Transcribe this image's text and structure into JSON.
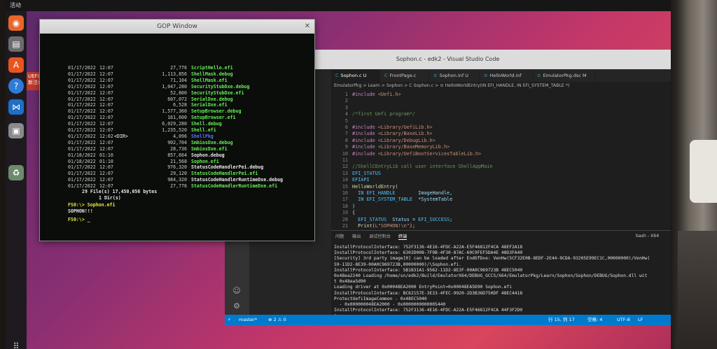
{
  "topbar": {
    "activities": "活动"
  },
  "dock": {
    "items": [
      {
        "name": "firefox-icon",
        "color": "#e8662a",
        "glyph": "◉"
      },
      {
        "name": "files-icon",
        "color": "#6c6c6c",
        "glyph": "▤"
      },
      {
        "name": "software-icon",
        "color": "#e95420",
        "glyph": "A"
      },
      {
        "name": "help-icon",
        "color": "#2f7bd8",
        "glyph": "?"
      },
      {
        "name": "vscode-icon",
        "color": "#1e6fc6",
        "glyph": "⋈"
      },
      {
        "name": "app-icon-1",
        "color": "#8a8a8a",
        "glyph": "▣"
      },
      {
        "name": "trash-icon",
        "color": "#6d8a6d",
        "glyph": "♻"
      }
    ],
    "uefi_label": "UEFI读\n新注卓"
  },
  "gop": {
    "title": "GOP Window",
    "rows": [
      {
        "date": "01/17/2022",
        "time": "12:07",
        "kind": "",
        "size": "27,776",
        "name": "ScriptHello.efi",
        "type": "file"
      },
      {
        "date": "01/17/2022",
        "time": "12:07",
        "kind": "",
        "size": "1,113,856",
        "name": "ShellMask.debug",
        "type": "file"
      },
      {
        "date": "01/17/2022",
        "time": "12:07",
        "kind": "",
        "size": "71,104",
        "name": "ShellMask.efi",
        "type": "file"
      },
      {
        "date": "01/17/2022",
        "time": "12:07",
        "kind": "",
        "size": "1,047,280",
        "name": "SecurityStubDxe.debug",
        "type": "file"
      },
      {
        "date": "01/17/2022",
        "time": "12:07",
        "kind": "",
        "size": "52,800",
        "name": "SecurityStubDxe.efi",
        "type": "file"
      },
      {
        "date": "01/17/2022",
        "time": "12:07",
        "kind": "",
        "size": "607,072",
        "name": "SerialDxe.debug",
        "type": "file"
      },
      {
        "date": "01/17/2022",
        "time": "12:07",
        "kind": "",
        "size": "6,528",
        "name": "SerialDxe.efi",
        "type": "file"
      },
      {
        "date": "01/17/2022",
        "time": "12:07",
        "kind": "",
        "size": "1,577,360",
        "name": "SetupBrowser.debug",
        "type": "file"
      },
      {
        "date": "01/17/2022",
        "time": "12:07",
        "kind": "",
        "size": "161,600",
        "name": "SetupBrowser.efi",
        "type": "file"
      },
      {
        "date": "01/17/2022",
        "time": "12:07",
        "kind": "",
        "size": "6,029,280",
        "name": "Shell.debug",
        "type": "file"
      },
      {
        "date": "01/17/2022",
        "time": "12:07",
        "kind": "",
        "size": "1,235,520",
        "name": "Shell.efi",
        "type": "file"
      },
      {
        "date": "01/17/2022",
        "time": "12:02",
        "kind": "<DIR>",
        "size": "4,096",
        "name": "ShellPkg",
        "type": "dir"
      },
      {
        "date": "01/17/2022",
        "time": "12:07",
        "kind": "",
        "size": "902,704",
        "name": "SmbiosDxe.debug",
        "type": "file"
      },
      {
        "date": "01/17/2022",
        "time": "12:07",
        "kind": "",
        "size": "28,736",
        "name": "SmbiosDxe.efi",
        "type": "file"
      },
      {
        "date": "01/18/2022",
        "time": "01:10",
        "kind": "",
        "size": "857,664",
        "name": "Sophon.debug",
        "type": "plain"
      },
      {
        "date": "01/18/2022",
        "time": "01:10",
        "kind": "",
        "size": "21,568",
        "name": "Sophon.efi",
        "type": "file"
      },
      {
        "date": "01/17/2022",
        "time": "12:07",
        "kind": "",
        "size": "976,320",
        "name": "StatusCodeHandlerPei.debug",
        "type": "plain"
      },
      {
        "date": "01/17/2022",
        "time": "12:07",
        "kind": "",
        "size": "29,120",
        "name": "StatusCodeHandlerPei.efi",
        "type": "file"
      },
      {
        "date": "01/17/2022",
        "time": "12:07",
        "kind": "",
        "size": "984,320",
        "name": "StatusCodeHandlerRuntimeDxe.debug",
        "type": "plain"
      },
      {
        "date": "01/17/2022",
        "time": "12:07",
        "kind": "",
        "size": "27,776",
        "name": "StatusCodeHandlerRuntimeDxe.efi",
        "type": "file"
      }
    ],
    "summary_files": "29 File(s)   17,450,056 bytes",
    "summary_dirs": "1 Dir(s)",
    "cmd": "FS0:\\> Sophon.efi",
    "output": "SOPHON!!!",
    "prompt": "FS0:\\> _"
  },
  "vscode": {
    "title": "Sophon.c - edk2 - Visual Studio Code",
    "tabs": [
      {
        "label": "Sophon.c U",
        "active": true
      },
      {
        "label": "FrontPage.c",
        "active": false
      },
      {
        "label": "Sophon.inf U",
        "active": false
      },
      {
        "label": "HelloWorld.inf",
        "active": false
      },
      {
        "label": "EmulatorPkg.dsc M",
        "active": false
      }
    ],
    "breadcrumb": "EmulatorPkg > Learn > Sophon > C Sophon.c > ⊙ HelloWorldEntry(IN EFI_HANDLE, IN EFI_SYSTEM_TABLE *)",
    "code": [
      {
        "ln": "1",
        "segs": [
          [
            "tk-pre",
            "#include "
          ],
          [
            "tk-str",
            "<Uefi.h>"
          ]
        ]
      },
      {
        "ln": "2",
        "segs": []
      },
      {
        "ln": "3",
        "segs": []
      },
      {
        "ln": "4",
        "segs": [
          [
            "tk-com",
            "/*first Uefi program*/"
          ]
        ]
      },
      {
        "ln": "5",
        "segs": []
      },
      {
        "ln": "6",
        "segs": [
          [
            "tk-pre",
            "#include "
          ],
          [
            "tk-str",
            "<Library/UefiLib.h>"
          ]
        ]
      },
      {
        "ln": "7",
        "segs": [
          [
            "tk-pre",
            "#include "
          ],
          [
            "tk-str",
            "<Library/BaseLib.h>"
          ]
        ]
      },
      {
        "ln": "8",
        "segs": [
          [
            "tk-pre",
            "#include "
          ],
          [
            "tk-str",
            "<Library/DebugLib.h>"
          ]
        ]
      },
      {
        "ln": "9",
        "segs": [
          [
            "tk-pre",
            "#include "
          ],
          [
            "tk-str",
            "<Library/BaseMemoryLib.h>"
          ]
        ]
      },
      {
        "ln": "10",
        "segs": [
          [
            "tk-pre",
            "#include "
          ],
          [
            "tk-str",
            "<Library/UefiBootServicesTableLib.h>"
          ]
        ]
      },
      {
        "ln": "11",
        "segs": []
      },
      {
        "ln": "12",
        "segs": [
          [
            "tk-com",
            "//ShellCEntryLib call user interface ShellAppMain"
          ]
        ]
      },
      {
        "ln": "13",
        "segs": [
          [
            "tk-mac",
            "EFI_STATUS"
          ]
        ]
      },
      {
        "ln": "14",
        "segs": [
          [
            "tk-mac",
            "EFIAPI"
          ]
        ]
      },
      {
        "ln": "15",
        "segs": [
          [
            "tk-fn",
            "HelloWorldEntry"
          ],
          [
            "tk-pl",
            "("
          ]
        ]
      },
      {
        "ln": "16",
        "segs": [
          [
            "tk-mac",
            "  IN EFI_HANDLE"
          ],
          [
            "tk-var",
            "        ImageHandle"
          ],
          [
            "tk-pl",
            ","
          ]
        ]
      },
      {
        "ln": "17",
        "segs": [
          [
            "tk-mac",
            "  IN EFI_SYSTEM_TABLE"
          ],
          [
            "tk-var",
            "  *SystemTable"
          ]
        ]
      },
      {
        "ln": "18",
        "segs": [
          [
            "tk-pl",
            ")"
          ]
        ]
      },
      {
        "ln": "19",
        "segs": [
          [
            "tk-pl",
            "{"
          ]
        ]
      },
      {
        "ln": "20",
        "segs": [
          [
            "tk-mac",
            "  EFI_STATUS"
          ],
          [
            "tk-var",
            "  Status"
          ],
          [
            "tk-pl",
            " = "
          ],
          [
            "tk-mac",
            "EFI_SUCCESS"
          ],
          [
            "tk-pl",
            ";"
          ]
        ]
      },
      {
        "ln": "21",
        "segs": [
          [
            "tk-fn",
            "  Print"
          ],
          [
            "tk-pl",
            "("
          ],
          [
            "tk-str",
            "L\"SOPHON!\\n\""
          ],
          [
            "tk-pl",
            ");"
          ]
        ]
      }
    ],
    "panel_tabs": [
      "问题",
      "输出",
      "调试控制台",
      "终端"
    ],
    "terminal_label": "bash - X64",
    "terminal": [
      "InstallProtocolInterface: 752F3136-4E16-4FDC-A22A-E5F46812F4CA 48EF2A18",
      "InstallProtocolInterface: 6302D008-7F9B-4F30-87AC-60C9FEF5DA4E 48D3FA40",
      "[Security] 3rd party image[0] can be loaded after EndOfDxe: VenHw(5CF32E0B-8EDF-2E44-9CDA-93205E99EC1C,00000000)/VenHw(",
      "59-11D2-8E39-00A0C969723B,00000000)/\\Sophon.efi.",
      "InstallProtocolInterface: 5B1B31A1-9562-11D2-8E3F-00A0C969723B 48EC5040",
      "0x48ea2240 Loading /home/sn/edk2/Build/EmulatorX64/DEBUG_GCC5/X64/EmulatorPkg/Learn/Sophon/Sophon/DEBUG/Sophon.dll wit",
      "t 0x48ea5d90",
      "Loading driver at 0x00048EA2000 EntryPoint=0x00048EA5D90 Sophon.efi",
      "InstallProtocolInterface: BC62157E-3E33-4FEC-9920-2D3B36D750DF 48EC4418",
      "ProtectUefiImageCommon - 0x48EC5040",
      "  - 0x000000048EA2000 - 0x0000000000005440",
      "InstallProtocolInterface: 752F3136-4E16-4FDC-A22A-E5F46812F4CA 44F3F2D0",
      "▯"
    ],
    "status": {
      "branch": "master*",
      "problems": "⊗ 2 ⚠ 0",
      "position": "行 15, 列 17",
      "spaces": "空格: 4",
      "encoding": "UTF-8",
      "eol": "LF"
    }
  }
}
